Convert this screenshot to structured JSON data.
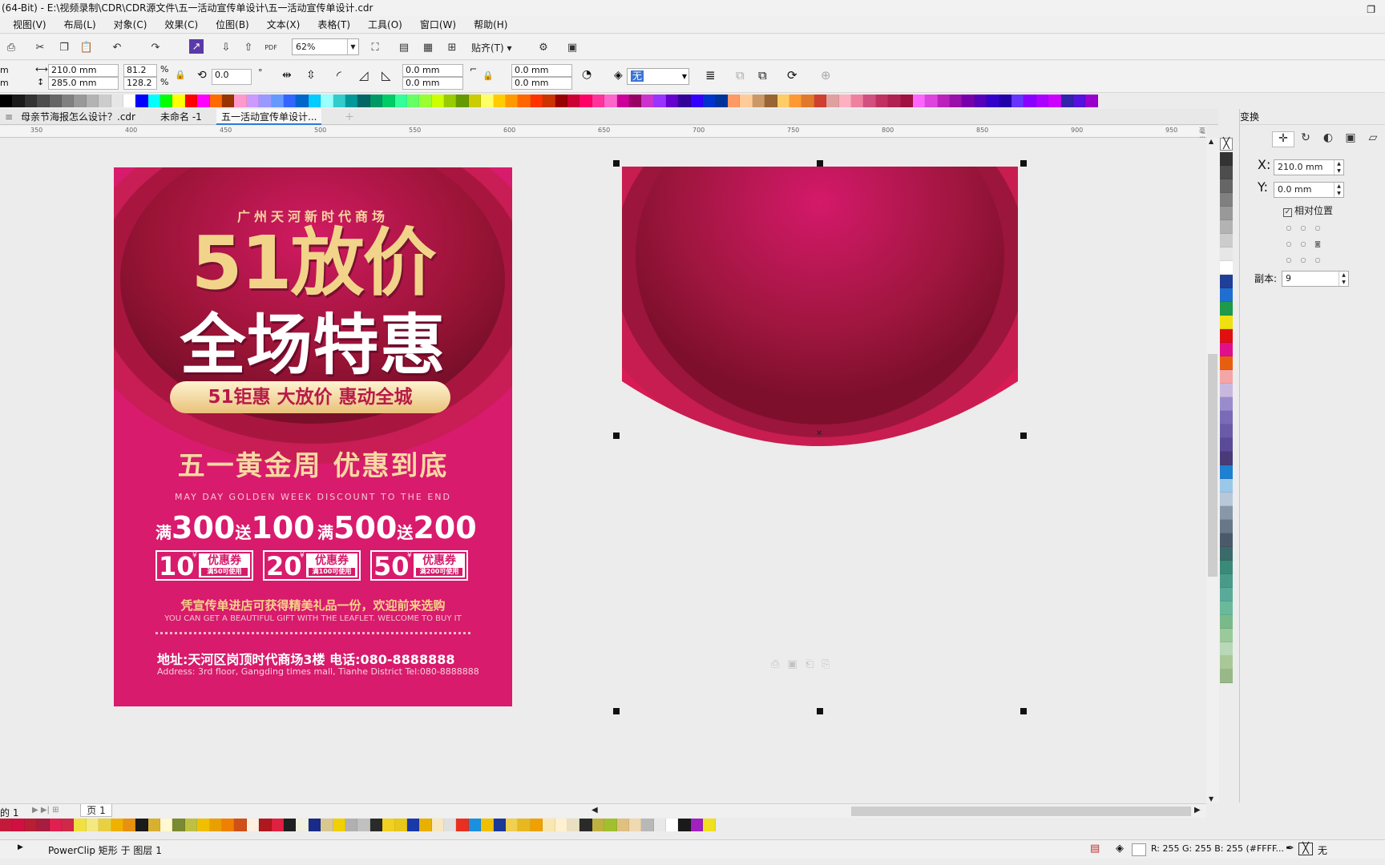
{
  "window": {
    "title": "(64-Bit) - E:\\视频录制\\CDR\\CDR源文件\\五一活动宣传单设计\\五一活动宣传单设计.cdr"
  },
  "menu": [
    "视图(V)",
    "布局(L)",
    "对象(C)",
    "效果(C)",
    "位图(B)",
    "文本(X)",
    "表格(T)",
    "工具(O)",
    "窗口(W)",
    "帮助(H)"
  ],
  "toolbar": {
    "zoom": "62%",
    "snap_label": "贴齐(T)",
    "pdf_label": "PDF"
  },
  "property_bar": {
    "width": "210.0 mm",
    "height": "285.0 mm",
    "scale_x": "81.2",
    "scale_y": "128.2",
    "percent": "%",
    "rotation": "0.0",
    "corner_tl": "0.0 mm",
    "corner_bl": "0.0 mm",
    "corner_tr": "0.0 mm",
    "corner_br": "0.0 mm",
    "fill": "无",
    "left_cut1": "m",
    "left_cut2": "m"
  },
  "doc_tabs": [
    "母亲节海报怎么设计？.cdr",
    "未命名 -1",
    "五一活动宣传单设计..."
  ],
  "ruler": {
    "ticks": [
      "350",
      "400",
      "450",
      "500",
      "550",
      "600",
      "650",
      "700",
      "750",
      "800",
      "850",
      "900",
      "950"
    ],
    "unit": "毫米"
  },
  "poster": {
    "store": "广州天河新时代商场",
    "headline1": "51放价",
    "headline2": "全场特惠",
    "pill": "51钜惠 大放价 惠动全城",
    "golden_week": "五一黄金周 优惠到底",
    "english_line": "MAY DAY GOLDEN WEEK DISCOUNT TO THE END",
    "offer1_pre": "满",
    "offer1_a": "300",
    "offer1_mid": "送",
    "offer1_b": "100",
    "offer2_pre": "满",
    "offer2_a": "500",
    "offer2_mid": "送",
    "offer2_b": "200",
    "coupons": [
      {
        "amount": "10",
        "label": "优惠券",
        "note": "满50可使用"
      },
      {
        "amount": "20",
        "label": "优惠券",
        "note": "满100可使用"
      },
      {
        "amount": "50",
        "label": "优惠券",
        "note": "满200可使用"
      }
    ],
    "yen": "¥",
    "gift": "凭宣传单进店可获得精美礼品一份，欢迎前来选购",
    "gift_en": "YOU CAN GET A BEAUTIFUL GIFT WITH THE LEAFLET. WELCOME TO BUY IT",
    "address": "地址:天河区岗顶时代商场3楼 电话:080-8888888",
    "address_en": "Address: 3rd floor, Gangding times mall, Tianhe District Tel:080-8888888"
  },
  "docker": {
    "title": "变换",
    "x_label": "X:",
    "x_value": "210.0 mm",
    "y_label": "Y:",
    "y_value": "0.0 mm",
    "relative_label": "相对位置",
    "copies_label": "副本:",
    "copies_value": "9"
  },
  "page_nav": {
    "of_label": "的 1",
    "page_tab": "页 1"
  },
  "status": {
    "object_info": "PowerClip 矩形 于 图层 1",
    "fill_color": "R: 255 G: 255 B: 255 (#FFFF...",
    "outline": "无"
  },
  "palette_top": [
    "#000000",
    "#1a1a1a",
    "#333333",
    "#4d4d4d",
    "#666666",
    "#808080",
    "#999999",
    "#b3b3b3",
    "#cccccc",
    "#e6e6e6",
    "#ffffff",
    "#0000ff",
    "#00ffff",
    "#00ff00",
    "#ffff00",
    "#ff0000",
    "#ff00ff",
    "#ff6a00",
    "#993300",
    "#ff99cc",
    "#cc99ff",
    "#9999ff",
    "#6699ff",
    "#3366ff",
    "#0066cc",
    "#00ccff",
    "#99ffff",
    "#33cccc",
    "#009999",
    "#006666",
    "#009966",
    "#00cc66",
    "#33ff99",
    "#66ff66",
    "#99ff33",
    "#ccff00",
    "#99cc00",
    "#669900",
    "#cccc00",
    "#ffff66",
    "#ffcc00",
    "#ff9900",
    "#ff6600",
    "#ff3300",
    "#cc3300",
    "#990000",
    "#cc0033",
    "#ff0066",
    "#ff3399",
    "#ff66cc",
    "#cc0099",
    "#990066",
    "#cc33cc",
    "#9933ff",
    "#6600cc",
    "#330099",
    "#3300ff",
    "#0033cc",
    "#003399",
    "#ff9966",
    "#ffcc99",
    "#cc9966",
    "#996633",
    "#ffcc66",
    "#ff9933",
    "#e07a2a",
    "#d04030",
    "#e0a0a0",
    "#ffb0c0",
    "#f080a0",
    "#d05080",
    "#c03060",
    "#b02050",
    "#a01040",
    "#ff66ff",
    "#dd44dd",
    "#bb22bb",
    "#9911aa",
    "#7700aa",
    "#5500bb",
    "#3300cc",
    "#2200aa",
    "#6633ff",
    "#8800ff",
    "#aa00ff",
    "#cc00ff",
    "#3322aa",
    "#5511dd",
    "#9900cc"
  ],
  "palette_right": [
    "#333333",
    "#4d4d4d",
    "#666666",
    "#808080",
    "#999999",
    "#b3b3b3",
    "#cccccc",
    "#e6e6e6",
    "#ffffff",
    "#1f3f99",
    "#1e6fd0",
    "#1f9a4a",
    "#f0e010",
    "#e01010",
    "#e0108a",
    "#e85e10",
    "#f4a6a6",
    "#c8b8e0",
    "#9a8ccc",
    "#7a6ab8",
    "#6a5aa8",
    "#5a4a98",
    "#4a3a78",
    "#1e80d0",
    "#9ac8e8",
    "#b8c8d8",
    "#8898a8",
    "#687888",
    "#4a5a6a",
    "#3a6a6a",
    "#3a8a7a",
    "#4a9a8a",
    "#5aaa9a",
    "#6aba9a",
    "#7aba8a",
    "#9aca9a",
    "#b8d8b8",
    "#a8c898",
    "#98b888"
  ],
  "palette_bottom": [
    "#c41a3a",
    "#d01040",
    "#b81e36",
    "#a81c40",
    "#e02050",
    "#d02848",
    "#f0e040",
    "#f4e880",
    "#e8d040",
    "#f0b000",
    "#e89010",
    "#1a1a1a",
    "#d8b030",
    "#fff8d0",
    "#7a8a30",
    "#c0c040",
    "#f0c000",
    "#e8a000",
    "#f08000",
    "#d05018",
    "#fff0e0",
    "#b01820",
    "#e02040",
    "#202020",
    "#f0f0e0",
    "#1a2a8a",
    "#d8c890",
    "#f0d000",
    "#b0b0b0",
    "#c0c0c0",
    "#2a2a2a",
    "#f0d020",
    "#e8c818",
    "#1a3aaa",
    "#e8b000",
    "#f8e8c0",
    "#e0e0e0",
    "#e83020",
    "#1a90e0",
    "#f0c000",
    "#1a3a9a",
    "#f0d050",
    "#e8b820",
    "#f0a000",
    "#f8e8b0",
    "#fff0d0",
    "#e8e0c0",
    "#2a2a2a",
    "#c0b040",
    "#a0c030",
    "#e0c080",
    "#f0d8b0",
    "#b8b8b8",
    "#e8e8e8",
    "#fff",
    "#1a1a1a",
    "#a020c0",
    "#f0e020"
  ]
}
